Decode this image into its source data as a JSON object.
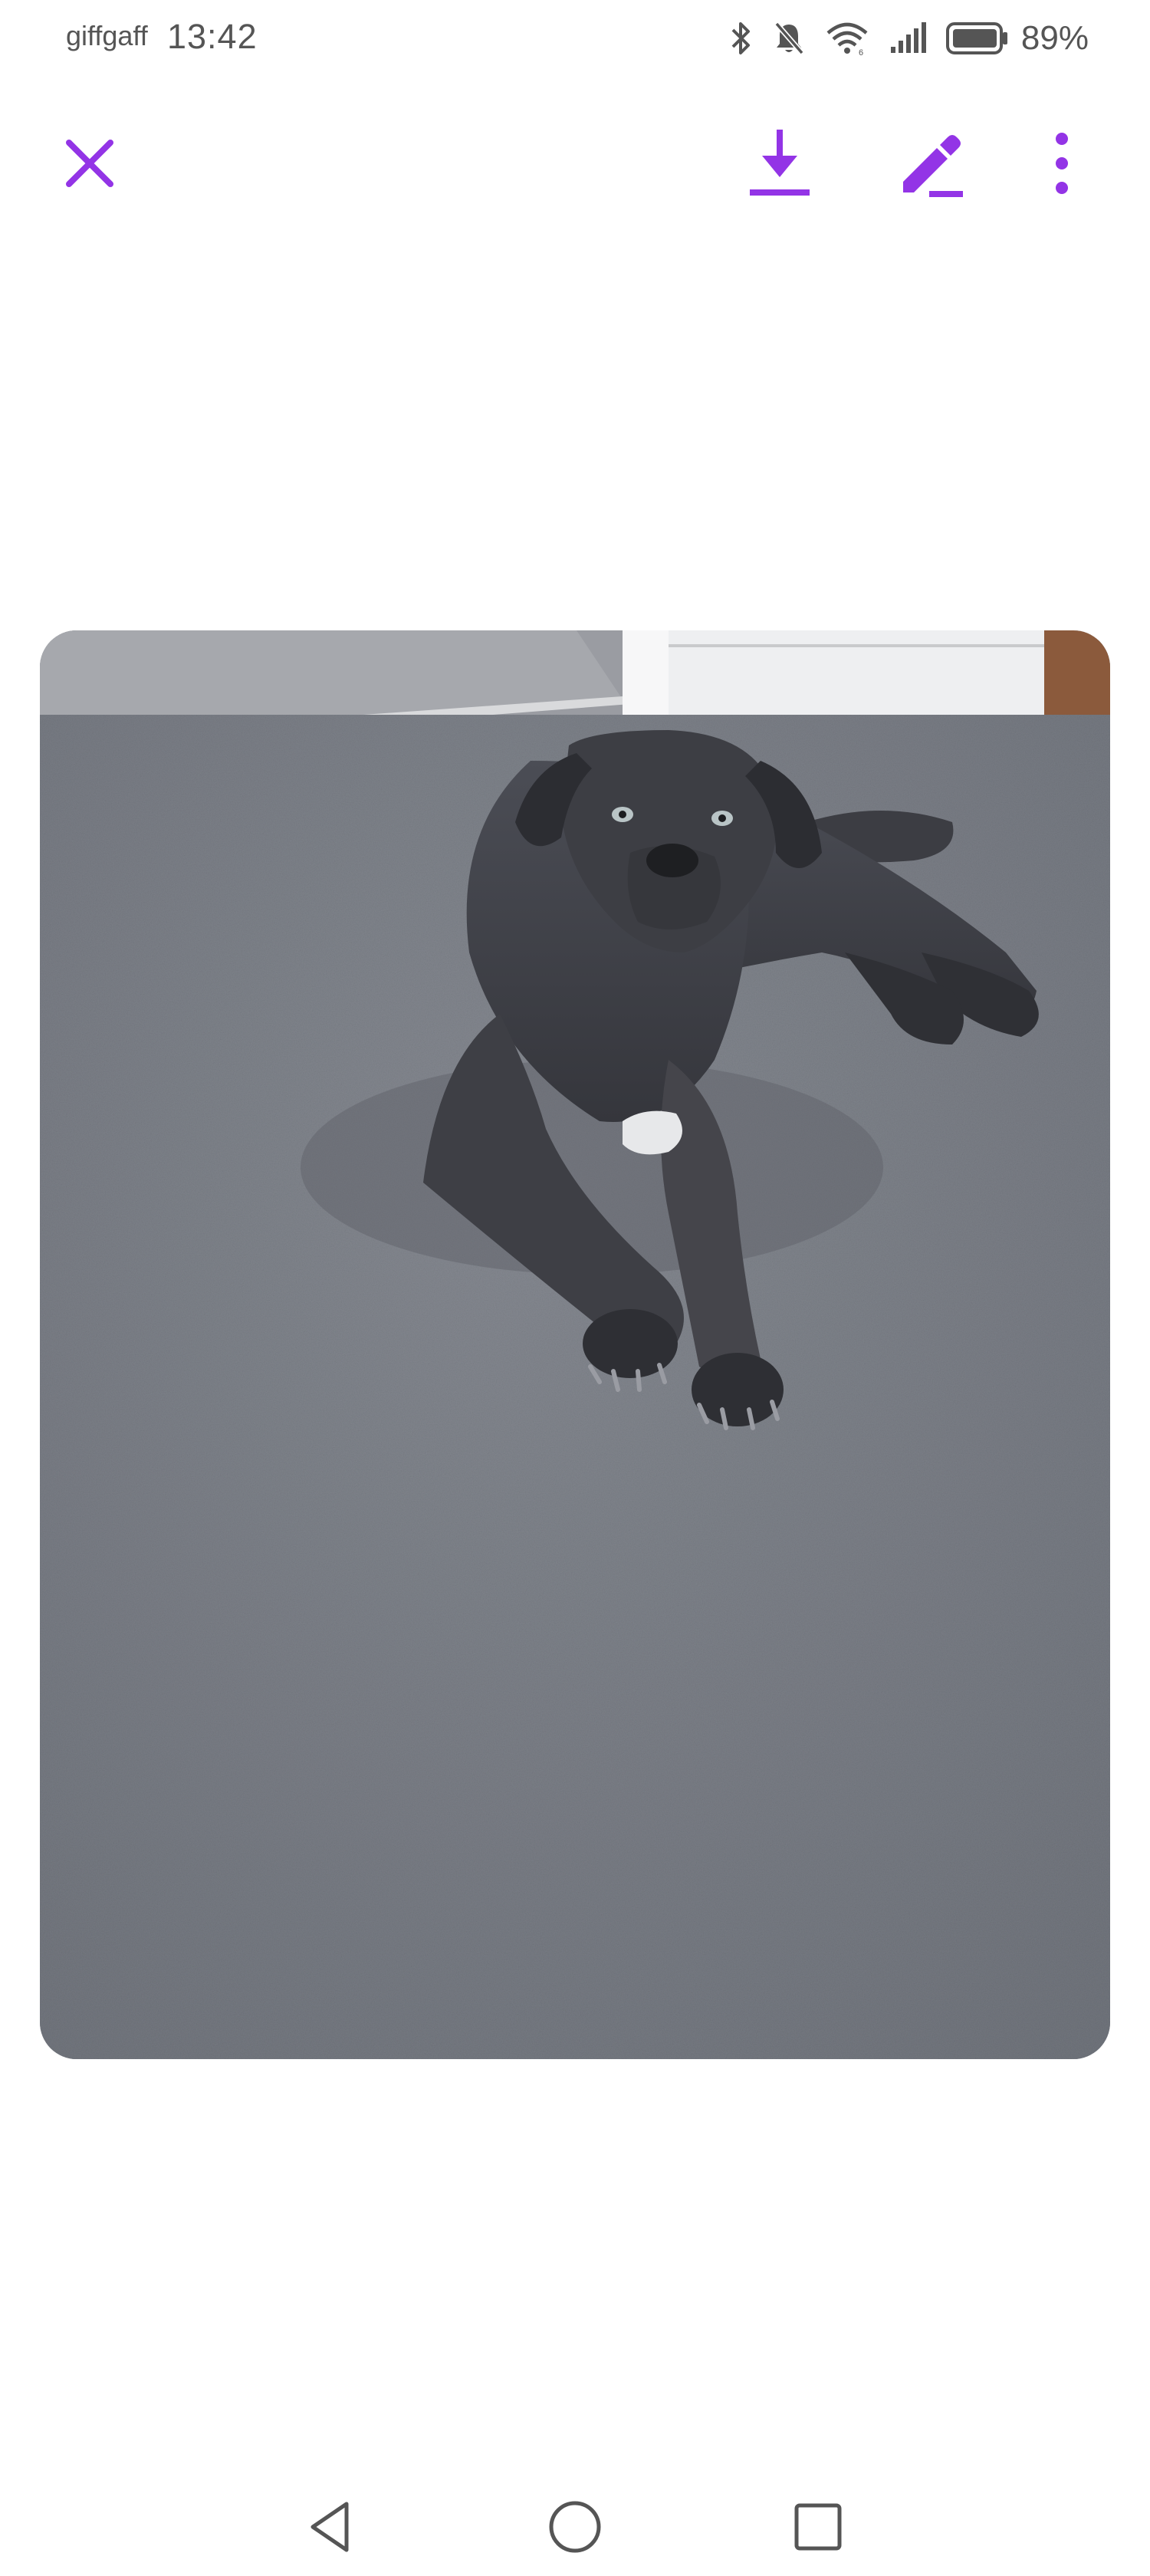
{
  "status_bar": {
    "carrier": "giffgaff",
    "time": "13:42",
    "battery": "89%",
    "icons": [
      "bluetooth-icon",
      "notifications-off-icon",
      "wifi-icon",
      "signal-icon",
      "battery-icon"
    ]
  },
  "toolbar": {
    "accent_color": "#9334e6",
    "close_icon": "close-icon",
    "download_icon": "download-icon",
    "edit_icon": "edit-icon",
    "more_icon": "more-vert-icon"
  },
  "viewer": {
    "icon": "photo"
  },
  "nav_bar": {
    "back_icon": "back-icon",
    "home_icon": "home-icon",
    "recents_icon": "recents-icon"
  }
}
